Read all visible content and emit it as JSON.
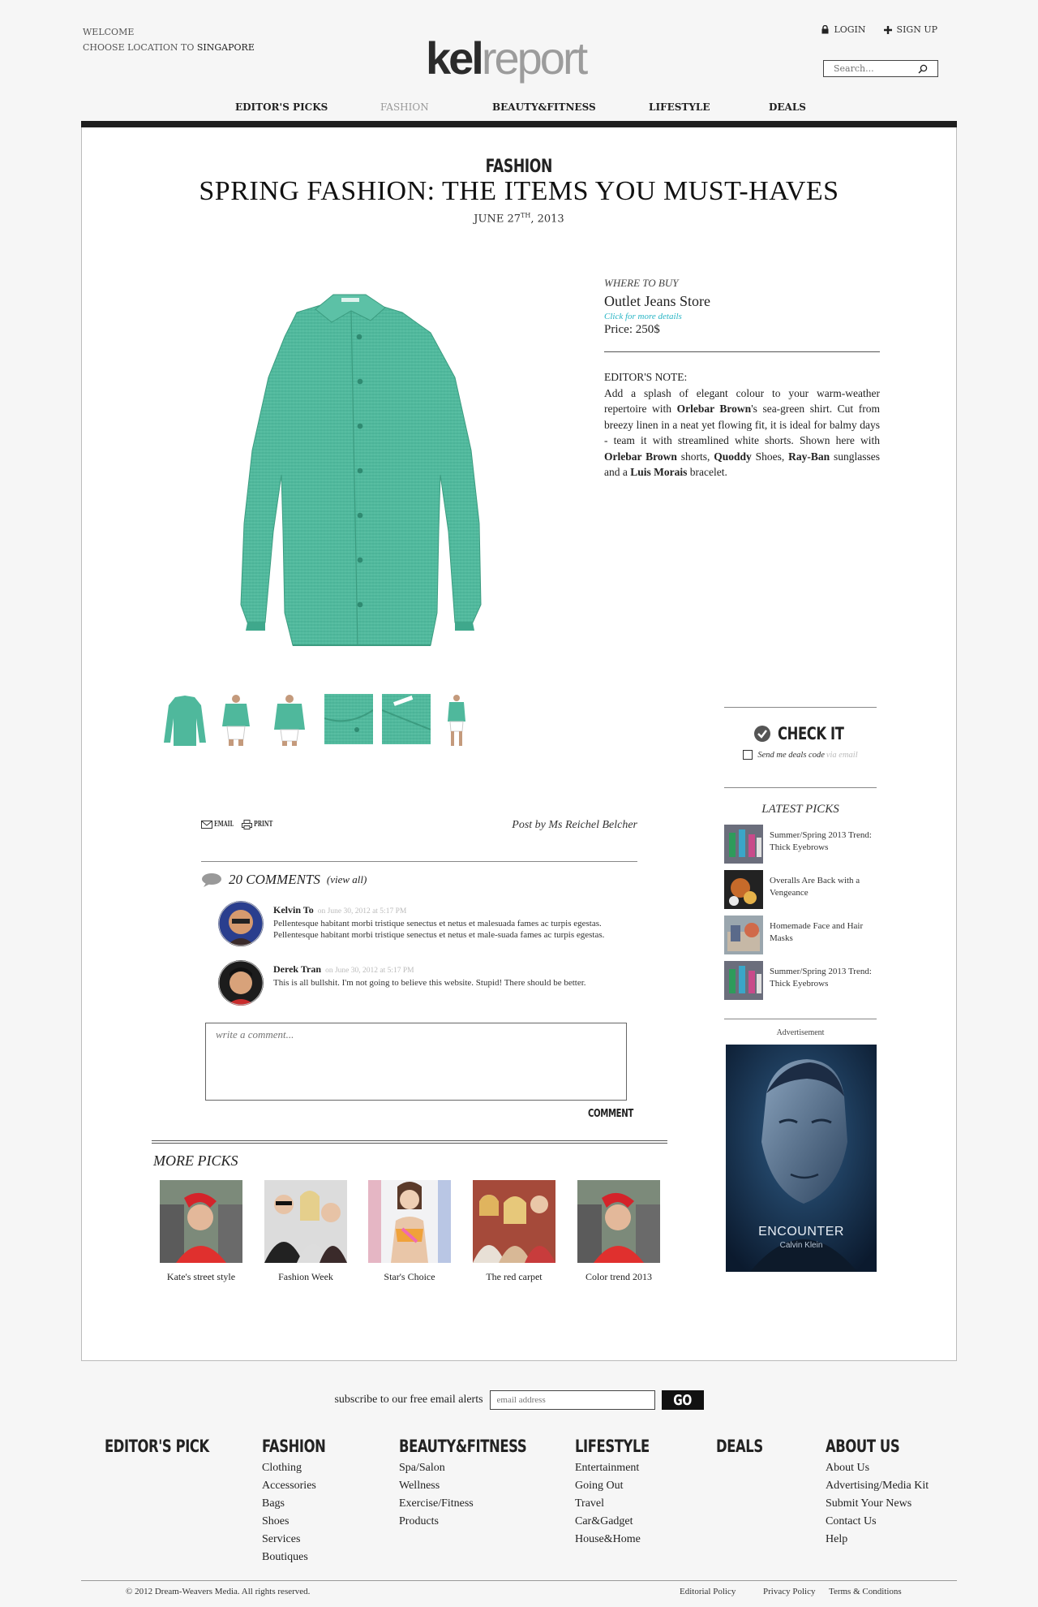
{
  "header": {
    "welcome": "WELCOME",
    "choose_location": "CHOOSE LOCATION TO",
    "location": "SINGAPORE",
    "logo_dark": "kel",
    "logo_light": "report",
    "login": "LOGIN",
    "signup": "SIGN UP",
    "search_placeholder": "Search..."
  },
  "nav": [
    "EDITOR'S PICKS",
    "FASHION",
    "BEAUTY&FITNESS",
    "LIFESTYLE",
    "DEALS"
  ],
  "nav_active": "FASHION",
  "article": {
    "section": "FASHION",
    "title": "SPRING FASHION: THE ITEMS YOU MUST-HAVES",
    "date_prefix": "JUNE 27",
    "date_sup": "TH",
    "date_suffix": ", 2013",
    "where_to_buy": "WHERE TO BUY",
    "store": "Outlet Jeans Store",
    "more_details": "Click for more details",
    "price": "Price: 250$",
    "note_label": "EDITOR'S NOTE:",
    "note_parts": [
      "Add a splash of elegant colour to your warm-weather repertoire with ",
      "Orlebar Brown",
      "'s sea-green shirt. Cut from breezy linen in a neat yet flowing fit, it is ideal for balmy days - team it with streamlined white shorts. Shown here with ",
      "Orlebar Brown",
      " shorts, ",
      "Quoddy",
      " Shoes, ",
      "Ray-Ban",
      " sunglasses and a ",
      "Luis Morais",
      " bracelet."
    ],
    "email": "EMAIL",
    "print": "PRINT",
    "post_by": "Post by Ms Reichel Belcher"
  },
  "comments": {
    "count_label": "20 COMMENTS",
    "view_all": "(view all)",
    "items": [
      {
        "name": "Kelvin To",
        "when": "on June 30, 2012 at 5:17 PM",
        "text": "Pellentesque habitant morbi tristique senectus et netus et malesuada fames ac turpis egestas. Pellentesque habitant morbi tristique senectus et netus et male-suada fames ac turpis egestas."
      },
      {
        "name": "Derek Tran",
        "when": "on June 30, 2012 at 5:17 PM",
        "text": "This is all bullshit. I'm not going to believe this website. Stupid! There should be better."
      }
    ],
    "write_placeholder": "write a comment...",
    "submit": "COMMENT"
  },
  "sidebar": {
    "check_it": "CHECK IT",
    "deals_label": "Send me deals code",
    "deals_via": "via email",
    "latest_title": "LATEST PICKS",
    "latest": [
      "Summer/Spring 2013 Trend: Thick Eyebrows",
      "Overalls Are Back with a Vengeance",
      "Homemade Face and Hair Masks",
      "Summer/Spring 2013 Trend: Thick Eyebrows"
    ],
    "ad_label": "Advertisement",
    "ad_brand": "ENCOUNTER",
    "ad_sub": "Calvin Klein"
  },
  "more_picks": {
    "title": "MORE PICKS",
    "items": [
      "Kate's street style",
      "Fashion Week",
      "Star's Choice",
      "The red carpet",
      "Color trend 2013"
    ]
  },
  "footer": {
    "subscribe_label": "subscribe to our free email alerts",
    "email_placeholder": "email address",
    "go": "GO",
    "columns": [
      {
        "title": "EDITOR'S PICK",
        "links": []
      },
      {
        "title": "FASHION",
        "links": [
          "Clothing",
          "Accessories",
          "Bags",
          "Shoes",
          "Services",
          "Boutiques"
        ]
      },
      {
        "title": "BEAUTY&FITNESS",
        "links": [
          "Spa/Salon",
          "Wellness",
          "Exercise/Fitness",
          "Products"
        ]
      },
      {
        "title": "LIFESTYLE",
        "links": [
          "Entertainment",
          "Going Out",
          "Travel",
          "Car&Gadget",
          "House&Home"
        ]
      },
      {
        "title": "DEALS",
        "links": []
      },
      {
        "title": "ABOUT US",
        "links": [
          "About Us",
          "Advertising/Media Kit",
          "Submit Your News",
          "Contact Us",
          "Help"
        ]
      }
    ],
    "copyright": "© 2012 Dream-Weavers Media. All rights reserved.",
    "legal": [
      "Editorial Policy",
      "Privacy Policy",
      "Terms & Conditions"
    ]
  },
  "colors": {
    "accent": "#27b4c4",
    "shirt": "#4db69a",
    "bar": "#1e1e1e"
  }
}
